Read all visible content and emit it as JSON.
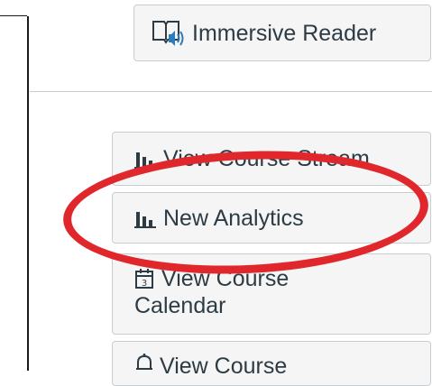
{
  "buttons": {
    "immersive_reader": {
      "label": "Immersive Reader",
      "icon": "immersive-reader-icon"
    },
    "view_course_stream": {
      "label": "View Course Stream",
      "icon": "analytics-bar-icon"
    },
    "new_analytics": {
      "label": "New Analytics",
      "icon": "analytics-bar-icon"
    },
    "view_course_calendar": {
      "label_line1": "View Course",
      "label_line2": "Calendar",
      "icon": "calendar-icon"
    },
    "view_course_notifications": {
      "label": "View Course",
      "icon": "bell-icon"
    }
  },
  "colors": {
    "button_bg": "#f5f5f5",
    "button_border": "#c7cdd1",
    "text": "#2d3b45",
    "highlight": "#e0272b",
    "icon_blue": "#2b7abc"
  }
}
